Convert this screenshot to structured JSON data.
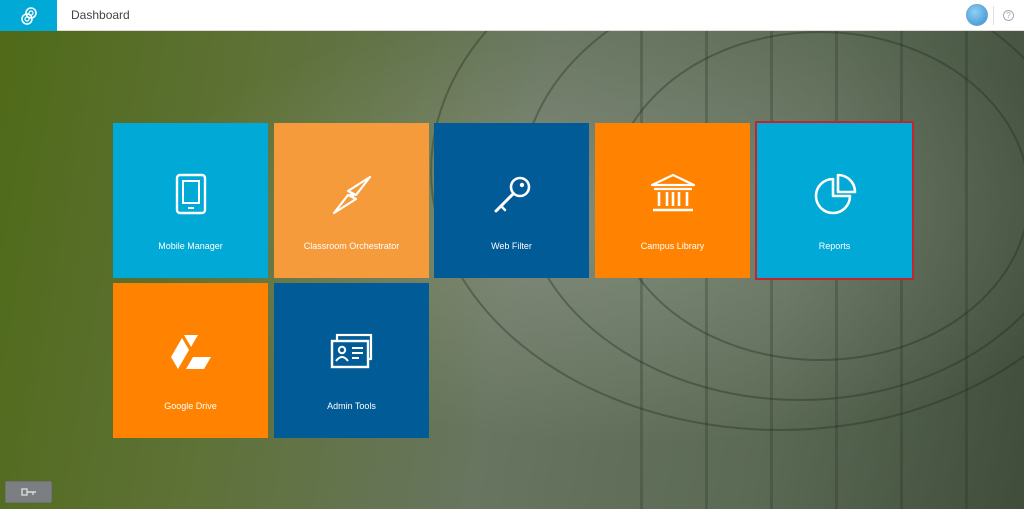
{
  "header": {
    "title": "Dashboard",
    "logo_icon": "apps-logo-icon",
    "avatar_icon": "user-avatar-icon",
    "help_icon": "help-icon",
    "help_glyph": "?"
  },
  "tiles": [
    {
      "label": "Mobile Manager",
      "icon": "tablet-icon",
      "color": "#00a9d6"
    },
    {
      "label": "Classroom Orchestrator",
      "icon": "compass-icon",
      "color": "#f59b3b"
    },
    {
      "label": "Web Filter",
      "icon": "key-icon",
      "color": "#005b96"
    },
    {
      "label": "Campus Library",
      "icon": "library-building-icon",
      "color": "#ff8200"
    },
    {
      "label": "Reports",
      "icon": "pie-chart-icon",
      "color": "#00a9d6",
      "selected": true
    },
    {
      "label": "Google Drive",
      "icon": "google-drive-icon",
      "color": "#ff8200"
    },
    {
      "label": "Admin Tools",
      "icon": "id-card-icon",
      "color": "#005b96"
    }
  ],
  "footer": {
    "key_button_icon": "key-icon"
  },
  "colors": {
    "cyan": "#00a9d6",
    "orange": "#ff8200",
    "light_orange": "#f59b3b",
    "dark_blue": "#005b96",
    "selection_border": "#c0262d"
  }
}
